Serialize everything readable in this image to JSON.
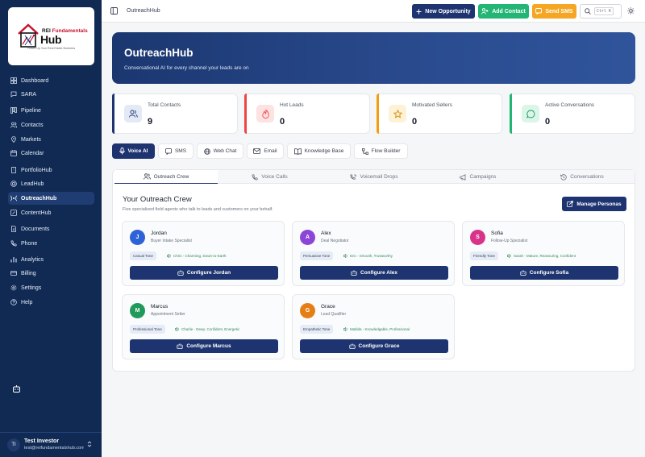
{
  "brand": {
    "line1_a": "REI ",
    "line1_b": "Fundamentals",
    "line2": "Hub",
    "tagline": "Power Up Your Real Estate Business"
  },
  "sidebar": {
    "items": [
      {
        "label": "Dashboard",
        "icon": "grid-icon",
        "active": false
      },
      {
        "label": "SARA",
        "icon": "chat-icon",
        "active": false
      },
      {
        "label": "Pipeline",
        "icon": "columns-icon",
        "active": false
      },
      {
        "label": "Contacts",
        "icon": "users-icon",
        "active": false
      },
      {
        "label": "Markets",
        "icon": "map-pin-icon",
        "active": false
      },
      {
        "label": "Calendar",
        "icon": "calendar-icon",
        "active": false
      },
      {
        "label": "PortfolioHub",
        "icon": "building-icon",
        "active": false
      },
      {
        "label": "LeadHub",
        "icon": "target-icon",
        "active": false
      },
      {
        "label": "OutreachHub",
        "icon": "broadcast-icon",
        "active": true
      },
      {
        "label": "ContentHub",
        "icon": "edit-icon",
        "active": false
      },
      {
        "label": "Documents",
        "icon": "file-icon",
        "active": false
      },
      {
        "label": "Phone",
        "icon": "phone-icon",
        "active": false
      },
      {
        "label": "Analytics",
        "icon": "bar-chart-icon",
        "active": false
      },
      {
        "label": "Billing",
        "icon": "credit-card-icon",
        "active": false
      },
      {
        "label": "Settings",
        "icon": "gear-icon",
        "active": false
      },
      {
        "label": "Help",
        "icon": "help-circle-icon",
        "active": false
      }
    ],
    "user": {
      "initials": "TI",
      "name": "Test Investor",
      "email": "test@reifundamentalshub.com"
    }
  },
  "topbar": {
    "title": "OutreachHub",
    "new_opportunity": "New Opportunity",
    "add_contact": "Add Contact",
    "send_sms": "Send SMS",
    "search_shortcut": "Ctrl K"
  },
  "hero": {
    "title": "OutreachHub",
    "subtitle": "Conversational AI for every channel your leads are on"
  },
  "stats": [
    {
      "label": "Total Contacts",
      "value": "9",
      "icon": "users-icon",
      "accent": "#1e3470"
    },
    {
      "label": "Hot Leads",
      "value": "0",
      "icon": "flame-icon",
      "accent": "#ef4444"
    },
    {
      "label": "Motivated Sellers",
      "value": "0",
      "icon": "star-icon",
      "accent": "#f59e0b"
    },
    {
      "label": "Active Conversations",
      "value": "0",
      "icon": "message-circle-icon",
      "accent": "#22b573"
    }
  ],
  "channels": [
    {
      "label": "Voice AI",
      "icon": "mic-icon",
      "active": true
    },
    {
      "label": "SMS",
      "icon": "message-square-icon",
      "active": false
    },
    {
      "label": "Web Chat",
      "icon": "globe-icon",
      "active": false
    },
    {
      "label": "Email",
      "icon": "mail-icon",
      "active": false
    },
    {
      "label": "Knowledge Base",
      "icon": "book-icon",
      "active": false
    },
    {
      "label": "Flow Builder",
      "icon": "workflow-icon",
      "active": false
    }
  ],
  "tabs": [
    {
      "label": "Outreach Crew",
      "icon": "users-icon",
      "active": true
    },
    {
      "label": "Voice Calls",
      "icon": "phone-icon",
      "active": false
    },
    {
      "label": "Voicemail Drops",
      "icon": "voicemail-icon",
      "active": false
    },
    {
      "label": "Campaigns",
      "icon": "megaphone-icon",
      "active": false
    },
    {
      "label": "Conversations",
      "icon": "history-icon",
      "active": false
    }
  ],
  "crew": {
    "title": "Your Outreach Crew",
    "subtitle": "Five specialized field agents who talk to leads and customers on your behalf.",
    "manage_label": "Manage Personas",
    "agents": [
      {
        "initial": "J",
        "name": "Jordan",
        "role": "Buyer Intake Specialist",
        "tone": "Casual Tone",
        "voice": "Chris - Charming, Down-to-Earth",
        "configure": "Configure Jordan",
        "color": "#2d63d6"
      },
      {
        "initial": "A",
        "name": "Alex",
        "role": "Deal Negotiator",
        "tone": "Persuasive Tone",
        "voice": "Eric - Smooth, Trustworthy",
        "configure": "Configure Alex",
        "color": "#8b45d8"
      },
      {
        "initial": "S",
        "name": "Sofia",
        "role": "Follow-Up Specialist",
        "tone": "Friendly Tone",
        "voice": "Sarah - Mature, Reassuring, Confident",
        "configure": "Configure Sofia",
        "color": "#d8338a"
      },
      {
        "initial": "M",
        "name": "Marcus",
        "role": "Appointment Setter",
        "tone": "Professional Tone",
        "voice": "Charlie - Deep, Confident, Energetic",
        "configure": "Configure Marcus",
        "color": "#1f9a5a"
      },
      {
        "initial": "G",
        "name": "Grace",
        "role": "Lead Qualifier",
        "tone": "Empathetic Tone",
        "voice": "Matilda - Knowledgable, Professional",
        "configure": "Configure Grace",
        "color": "#e67e16"
      }
    ]
  }
}
